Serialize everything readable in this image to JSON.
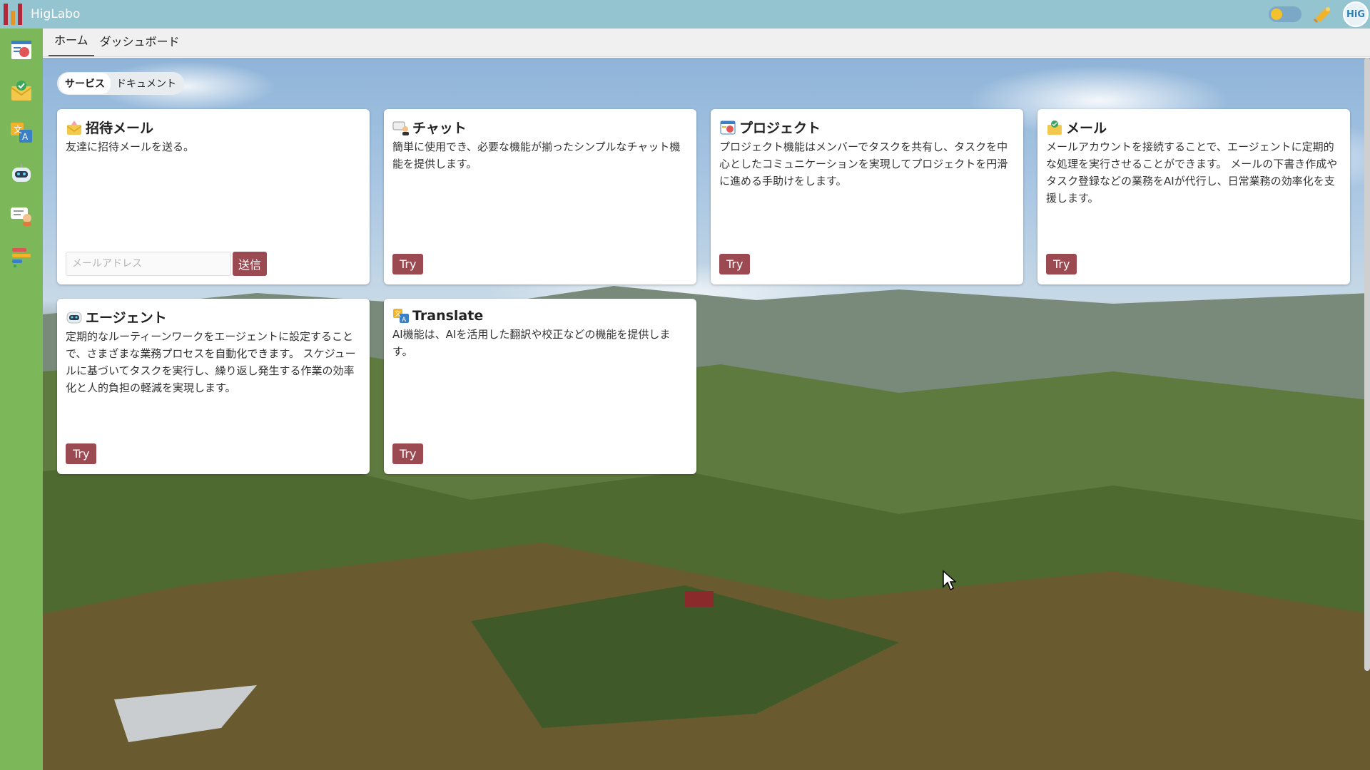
{
  "app": {
    "title": "HigLabo",
    "avatar_text": "HiG"
  },
  "tabs": [
    {
      "label": "ホーム",
      "active": true
    },
    {
      "label": "ダッシュボード",
      "active": false
    }
  ],
  "segment": [
    {
      "label": "サービス",
      "active": true
    },
    {
      "label": "ドキュメント",
      "active": false
    }
  ],
  "cards": [
    {
      "title": "招待メール",
      "icon": "invite-mail-icon",
      "description": "友達に招待メールを送る。",
      "input_placeholder": "メールアドレス",
      "send_label": "送信"
    },
    {
      "title": "チャット",
      "icon": "chat-icon",
      "description": "簡単に使用でき、必要な機能が揃ったシンプルなチャット機能を提供します。",
      "button": "Try"
    },
    {
      "title": "プロジェクト",
      "icon": "project-icon",
      "description": "プロジェクト機能はメンバーでタスクを共有し、タスクを中心としたコミュニケーションを実現してプロジェクトを円滑に進める手助けをします。",
      "button": "Try"
    },
    {
      "title": "メール",
      "icon": "mail-icon",
      "description": "メールアカウントを接続することで、エージェントに定期的な処理を実行させることができます。 メールの下書き作成やタスク登録などの業務をAIが代行し、日常業務の効率化を支援します。",
      "button": "Try"
    },
    {
      "title": "エージェント",
      "icon": "agent-icon",
      "description": "定期的なルーティーンワークをエージェントに設定することで、さまざまな業務プロセスを自動化できます。 スケジュールに基づいてタスクを実行し、繰り返し発生する作業の効率化と人的負担の軽減を実現します。",
      "button": "Try"
    },
    {
      "title": "Translate",
      "icon": "translate-icon",
      "description": "AI機能は、AIを活用した翻訳や校正などの機能を提供します。",
      "button": "Try"
    }
  ],
  "sidebar": [
    {
      "icon": "project-icon"
    },
    {
      "icon": "mail-icon"
    },
    {
      "icon": "translate-icon"
    },
    {
      "icon": "agent-icon"
    },
    {
      "icon": "chat-icon"
    },
    {
      "icon": "dashboard-icon"
    }
  ],
  "colors": {
    "topbar": "#93c4cf",
    "sidebar": "#7cb75a",
    "button": "#9c4a52"
  }
}
